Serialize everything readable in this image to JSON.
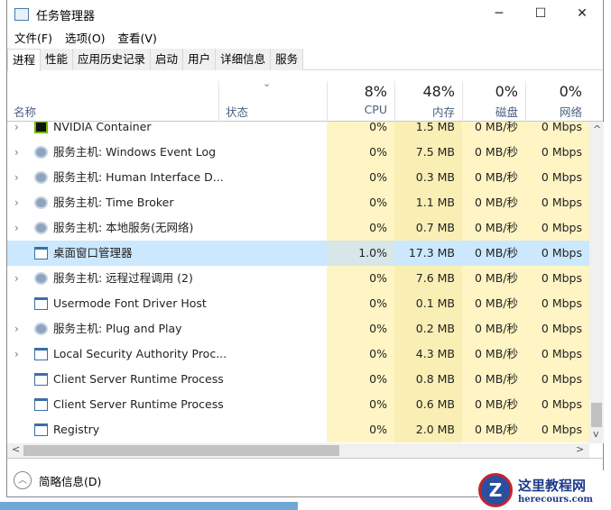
{
  "title": "任务管理器",
  "window_controls": {
    "minimize": "─",
    "maximize": "☐",
    "close": "✕"
  },
  "menu": [
    "文件(F)",
    "选项(O)",
    "查看(V)"
  ],
  "tabs": [
    "进程",
    "性能",
    "应用历史记录",
    "启动",
    "用户",
    "详细信息",
    "服务"
  ],
  "columns": {
    "name": "名称",
    "status": "状态",
    "cpu": {
      "pct": "8%",
      "label": "CPU"
    },
    "mem": {
      "pct": "48%",
      "label": "内存"
    },
    "disk": {
      "pct": "0%",
      "label": "磁盘"
    },
    "net": {
      "pct": "0%",
      "label": "网络"
    }
  },
  "rows": [
    {
      "name": "NVIDIA Container",
      "cpu": "0%",
      "mem": "1.5 MB",
      "disk": "0 MB/秒",
      "net": "0 Mbps",
      "icon": "nvidia",
      "expand": true
    },
    {
      "name": "服务主机: Windows Event Log",
      "cpu": "0%",
      "mem": "7.5 MB",
      "disk": "0 MB/秒",
      "net": "0 Mbps",
      "icon": "gear",
      "expand": true
    },
    {
      "name": "服务主机: Human Interface D...",
      "cpu": "0%",
      "mem": "0.3 MB",
      "disk": "0 MB/秒",
      "net": "0 Mbps",
      "icon": "gear",
      "expand": true
    },
    {
      "name": "服务主机: Time Broker",
      "cpu": "0%",
      "mem": "1.1 MB",
      "disk": "0 MB/秒",
      "net": "0 Mbps",
      "icon": "gear",
      "expand": true
    },
    {
      "name": "服务主机: 本地服务(无网络)",
      "cpu": "0%",
      "mem": "0.7 MB",
      "disk": "0 MB/秒",
      "net": "0 Mbps",
      "icon": "gear",
      "expand": true
    },
    {
      "name": "桌面窗口管理器",
      "cpu": "1.0%",
      "mem": "17.3 MB",
      "disk": "0 MB/秒",
      "net": "0 Mbps",
      "icon": "window",
      "expand": false,
      "selected": true
    },
    {
      "name": "服务主机: 远程过程调用 (2)",
      "cpu": "0%",
      "mem": "7.6 MB",
      "disk": "0 MB/秒",
      "net": "0 Mbps",
      "icon": "gear",
      "expand": true
    },
    {
      "name": "Usermode Font Driver Host",
      "cpu": "0%",
      "mem": "0.1 MB",
      "disk": "0 MB/秒",
      "net": "0 Mbps",
      "icon": "window",
      "expand": false
    },
    {
      "name": "服务主机: Plug and Play",
      "cpu": "0%",
      "mem": "0.2 MB",
      "disk": "0 MB/秒",
      "net": "0 Mbps",
      "icon": "gear",
      "expand": true
    },
    {
      "name": "Local Security Authority Proc...",
      "cpu": "0%",
      "mem": "4.3 MB",
      "disk": "0 MB/秒",
      "net": "0 Mbps",
      "icon": "window",
      "expand": true
    },
    {
      "name": "Client Server Runtime Process",
      "cpu": "0%",
      "mem": "0.8 MB",
      "disk": "0 MB/秒",
      "net": "0 Mbps",
      "icon": "window",
      "expand": false
    },
    {
      "name": "Client Server Runtime Process",
      "cpu": "0%",
      "mem": "0.6 MB",
      "disk": "0 MB/秒",
      "net": "0 Mbps",
      "icon": "window",
      "expand": false
    },
    {
      "name": "Registry",
      "cpu": "0%",
      "mem": "2.0 MB",
      "disk": "0 MB/秒",
      "net": "0 Mbps",
      "icon": "window",
      "expand": false
    }
  ],
  "footer": {
    "fewer_details": "简略信息(D)"
  },
  "watermark": {
    "title": "这里教程网",
    "url": "herecours.com",
    "letter": "Z"
  }
}
